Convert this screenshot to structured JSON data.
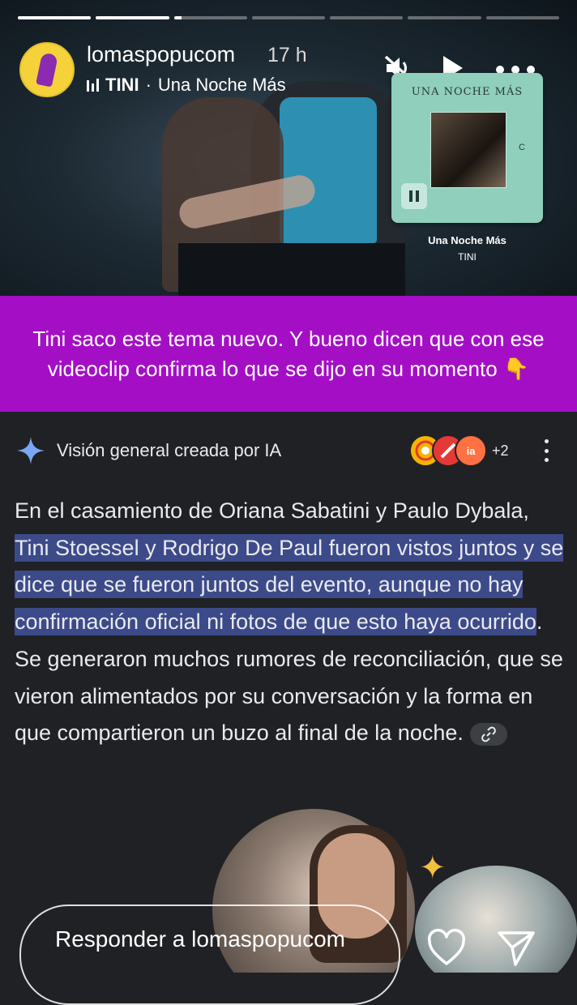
{
  "story": {
    "progress": [
      1,
      1,
      0.1,
      0,
      0,
      0,
      0
    ],
    "username": "lomaspopucom",
    "time": "17 h",
    "music_artist": "TINI",
    "music_sep": "·",
    "music_song": "Una Noche Más",
    "music_card": {
      "cover_title": "UNA NOCHE MÁS",
      "cover_label": "C",
      "song": "Una Noche Más",
      "artist": "TINI"
    },
    "caption": "Tini saco este tema nuevo. Y bueno dicen que con ese videoclip confirma lo que se dijo en su momento 👇"
  },
  "ai_overview": {
    "title": "Visión general creada por IA",
    "sources_extra": "+2",
    "source_badges": [
      {
        "text": "",
        "color": "#f4b400"
      },
      {
        "text": "",
        "color": "#e53935"
      },
      {
        "text": "ia",
        "color": "#ff7043"
      }
    ],
    "text_part1": "En el casamiento de Oriana Sabatini y Paulo Dybala, ",
    "text_highlight": "Tini Stoessel y Rodrigo De Paul fueron vistos juntos y se dice que se fueron juntos del evento, aunque no hay confirmación oficial ni fotos de que esto haya ocurrido",
    "text_part2": ". Se generaron muchos rumores de reconciliación, que se vieron alimentados por su conversación y la forma en que compartieron un buzo al final de la noche."
  },
  "reply": {
    "placeholder": "Responder a lomaspopucom"
  },
  "colors": {
    "caption_bg": "#a40fc6",
    "highlight": "#3d4a8a",
    "background": "#202124"
  },
  "icons": [
    "mute-icon",
    "play-icon",
    "more-icon",
    "sparkle-icon",
    "kebab-icon",
    "link-icon",
    "heart-icon",
    "send-icon"
  ]
}
